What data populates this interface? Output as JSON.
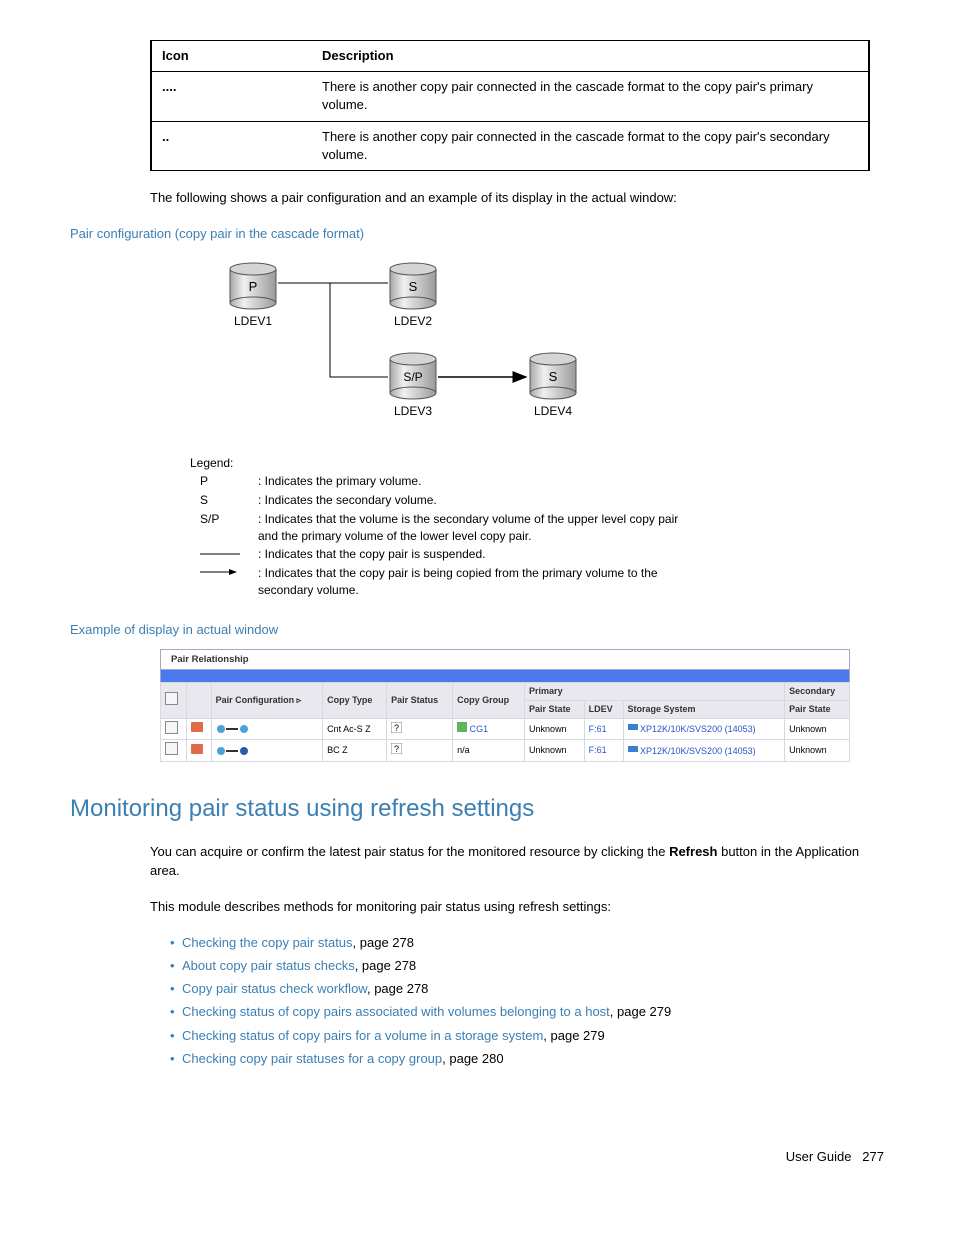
{
  "table": {
    "head": {
      "icon": "Icon",
      "desc": "Description"
    },
    "rows": [
      {
        "icon": "....",
        "desc": "There is another copy pair connected in the cascade format to the copy pair's primary volume."
      },
      {
        "icon": "..",
        "desc": "There is another copy pair connected in the cascade format to the copy pair's secondary volume."
      }
    ]
  },
  "para1": "The following shows a pair configuration and an example of its display in the actual window:",
  "caption1": "Pair configuration (copy pair in the cascade format)",
  "diagram": {
    "p": "P",
    "s": "S",
    "sp": "S/P",
    "ldev1": "LDEV1",
    "ldev2": "LDEV2",
    "ldev3": "LDEV3",
    "ldev4": "LDEV4",
    "legend_title": "Legend:",
    "rows": [
      {
        "k": "P",
        "v": ": Indicates the primary volume."
      },
      {
        "k": "S",
        "v": ": Indicates the secondary volume."
      },
      {
        "k": "S/P",
        "v": ": Indicates that the volume is the secondary volume of the upper level copy pair and the primary volume of the lower level copy pair."
      },
      {
        "k": "",
        "v": ": Indicates that the copy pair is suspended."
      },
      {
        "k": "",
        "v": ": Indicates that the copy pair is being copied from the primary volume to the secondary volume."
      }
    ]
  },
  "caption2": "Example of display in actual window",
  "window": {
    "title": "Pair Relationship",
    "head": {
      "pairconf": "Pair Configuration",
      "copytype": "Copy Type",
      "pairstatus": "Pair Status",
      "copygroup": "Copy Group",
      "primary": "Primary",
      "secondary": "Secondary",
      "pairstate": "Pair State",
      "ldev": "LDEV",
      "storage": "Storage System"
    },
    "rows": [
      {
        "ct": "Cnt Ac-S Z",
        "cg": "CG1",
        "ps": "Unknown",
        "ldev": "F:61",
        "ss": "XP12K/10K/SVS200 (14053)",
        "sps": "Unknown"
      },
      {
        "ct": "BC Z",
        "cg": "n/a",
        "ps": "Unknown",
        "ldev": "F:61",
        "ss": "XP12K/10K/SVS200 (14053)",
        "sps": "Unknown"
      }
    ]
  },
  "section_title": "Monitoring pair status using refresh settings",
  "para2a": "You can acquire or confirm the latest pair status for the monitored resource by clicking the ",
  "para2b": "Refresh",
  "para2c": " button in the Application area.",
  "para3": "This module describes methods for monitoring pair status using refresh settings:",
  "links": [
    {
      "t": "Checking the copy pair status",
      "p": ", page 278"
    },
    {
      "t": "About copy pair status checks",
      "p": ", page 278"
    },
    {
      "t": "Copy pair status check workflow",
      "p": ", page 278"
    },
    {
      "t": "Checking status of copy pairs associated with volumes belonging to a host",
      "p": ", page 279"
    },
    {
      "t": "Checking status of copy pairs for a volume in a storage system",
      "p": ", page 279"
    },
    {
      "t": "Checking copy pair statuses for a copy group",
      "p": ", page 280"
    }
  ],
  "footer": {
    "label": "User Guide",
    "page": "277"
  }
}
